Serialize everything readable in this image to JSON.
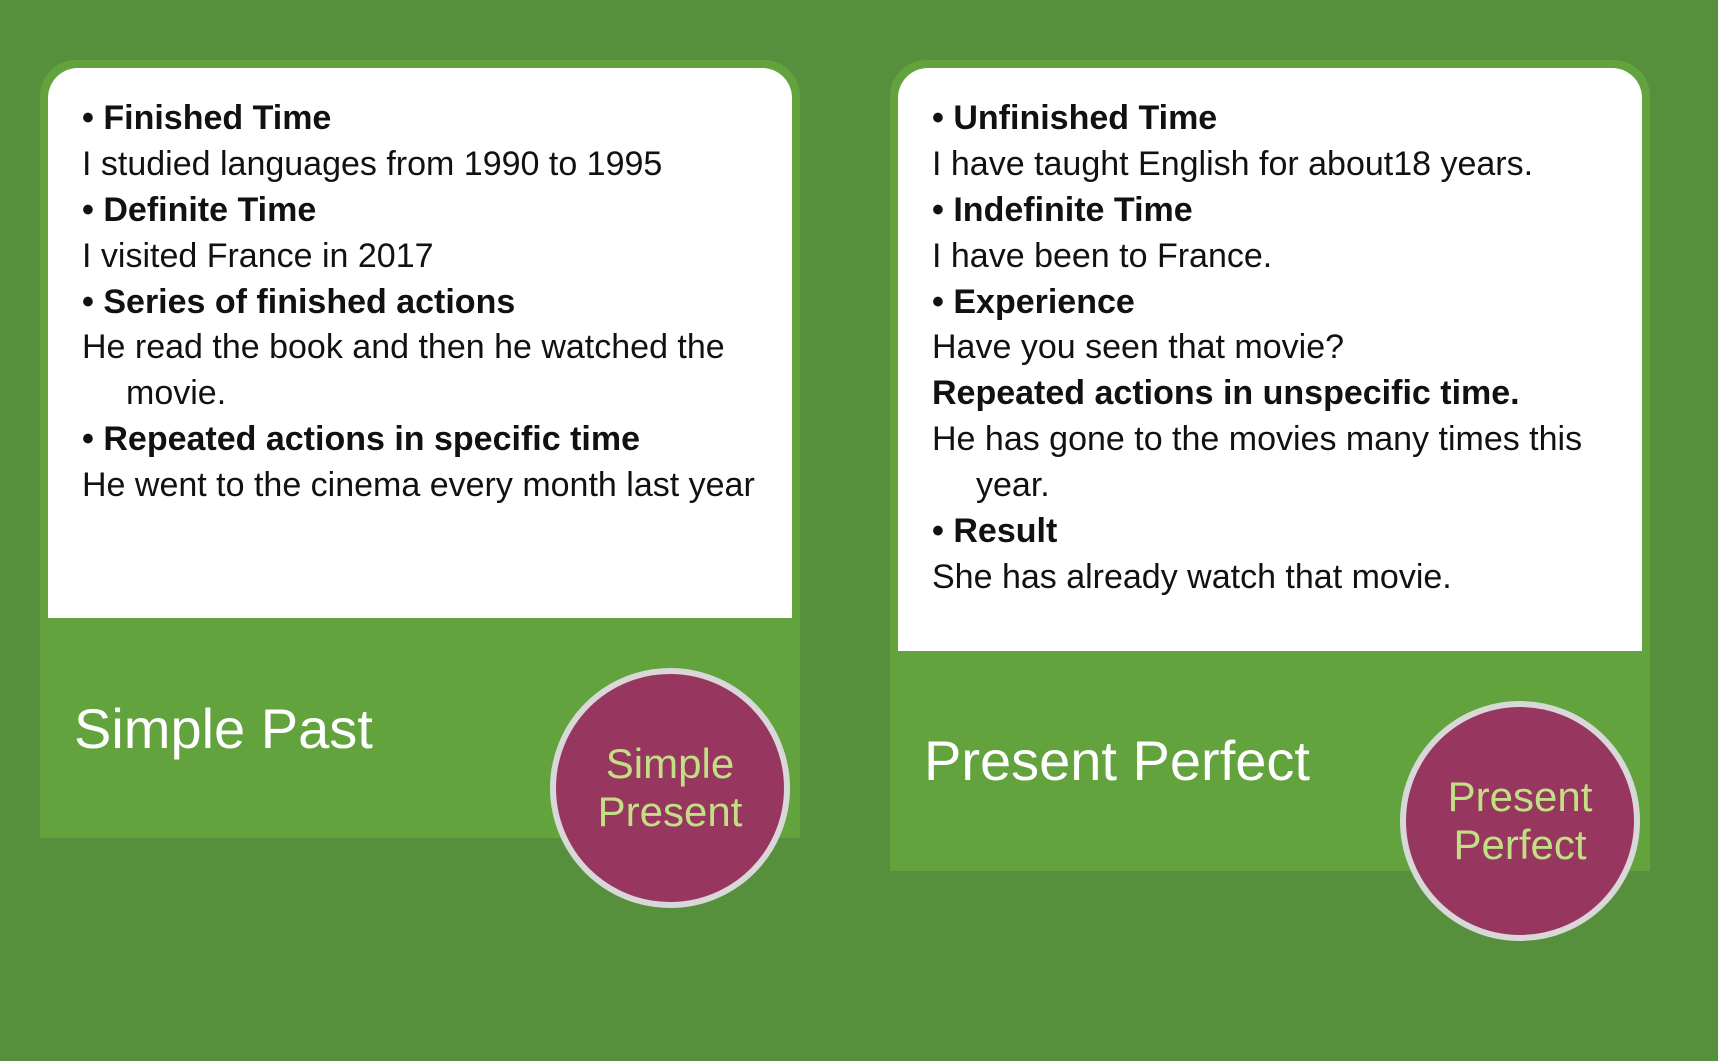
{
  "cards": [
    {
      "title": "Simple Past",
      "badge_line1": "Simple",
      "badge_line2": "Present",
      "items": [
        {
          "head": "Finished Time",
          "ex": "I studied languages from 1990 to 1995"
        },
        {
          "head": "Definite Time",
          "ex": "I visited France in 2017"
        },
        {
          "head": "Series of finished actions",
          "ex": "He read the book and then he watched the movie."
        },
        {
          "head": "Repeated actions in specific time",
          "ex": "He went to the cinema every month last year"
        }
      ]
    },
    {
      "title": "Present Perfect",
      "badge_line1": "Present",
      "badge_line2": "Perfect",
      "items": [
        {
          "head": "Unfinished Time",
          "ex": "I have taught English for about18 years."
        },
        {
          "head": "Indefinite Time",
          "ex": "I have been to France."
        },
        {
          "head": "Experience",
          "ex": "Have you seen that movie?"
        },
        {
          "head_nobullet": "Repeated actions in unspecific time.",
          "ex": "He has gone to the movies many times this year."
        },
        {
          "head": "Result",
          "ex": "She has already watch that movie."
        }
      ]
    }
  ]
}
